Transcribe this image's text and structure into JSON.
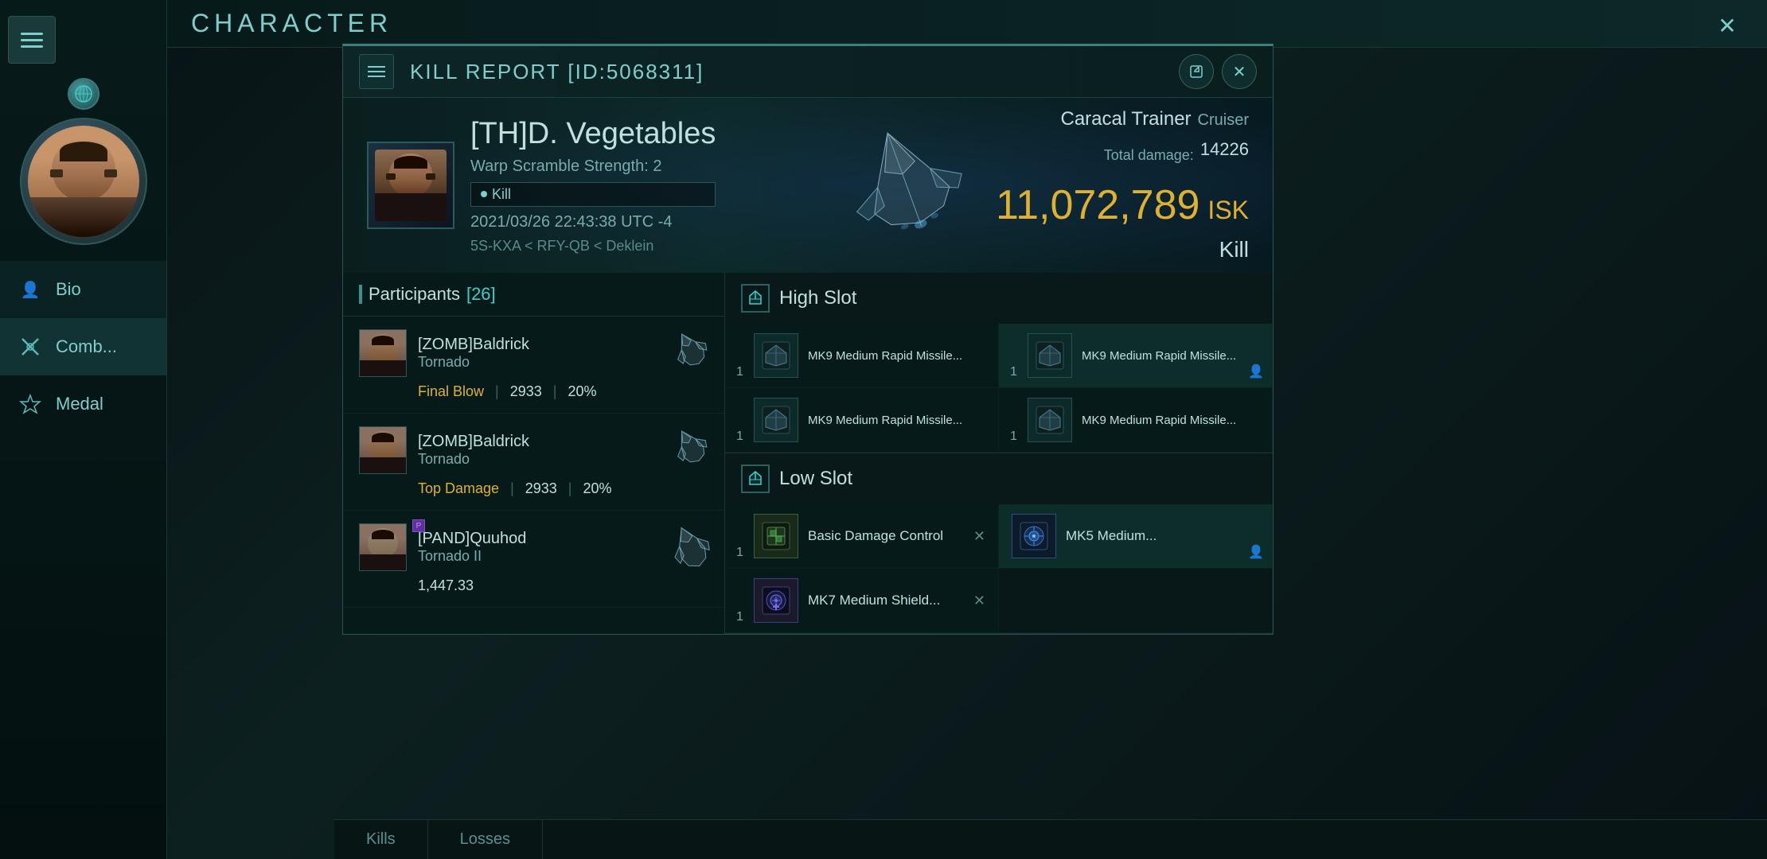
{
  "window": {
    "title": "CHARACTER",
    "close_label": "✕"
  },
  "sidebar": {
    "menu_label": "≡",
    "logo_text": "CHARACTER",
    "bio_label": "Bio",
    "nav_items": [
      {
        "id": "combat",
        "label": "Comb...",
        "icon": "⚔"
      },
      {
        "id": "medal",
        "label": "Medal",
        "icon": "★"
      }
    ]
  },
  "modal": {
    "title": "KILL REPORT [ID:5068311]",
    "export_icon": "↗",
    "close_icon": "✕"
  },
  "kill_banner": {
    "pilot_name": "[TH]D. Vegetables",
    "warp_scramble": "Warp Scramble Strength: 2",
    "kill_tag": "Kill",
    "datetime": "2021/03/26 22:43:38 UTC -4",
    "location": "5S-KXA < RFY-QB < Deklein",
    "ship_name": "Caracal Trainer",
    "ship_type": "Cruiser",
    "total_damage_label": "Total damage:",
    "total_damage_value": "14226",
    "isk_value": "11,072,789",
    "isk_label": "ISK",
    "result": "Kill"
  },
  "participants": {
    "header": "Participants",
    "count": "[26]",
    "items": [
      {
        "name": "[ZOMB]Baldrick",
        "ship": "Tornado",
        "tag": "Final Blow",
        "damage": "2933",
        "pct": "20%"
      },
      {
        "name": "[ZOMB]Baldrick",
        "ship": "Tornado",
        "tag": "Top Damage",
        "damage": "2933",
        "pct": "20%"
      },
      {
        "name": "[PAND]Quuhod",
        "ship": "Tornado II",
        "tag": "",
        "damage": "1,447.33",
        "pct": ""
      }
    ]
  },
  "fitting": {
    "high_slot": {
      "title": "High Slot",
      "items": [
        {
          "qty": "1",
          "name": "MK9 Medium Rapid Missile...",
          "highlighted": false
        },
        {
          "qty": "1",
          "name": "MK9 Medium Rapid Missile...",
          "highlighted": true
        },
        {
          "qty": "1",
          "name": "MK9 Medium Rapid Missile...",
          "highlighted": false
        },
        {
          "qty": "1",
          "name": "MK9 Medium Rapid Missile...",
          "highlighted": false
        }
      ]
    },
    "low_slot": {
      "title": "Low Slot",
      "items": [
        {
          "qty": "1",
          "name": "Basic Damage Control",
          "highlighted": false,
          "removable": true
        },
        {
          "qty": "",
          "name": "MK5 Medium...",
          "highlighted": true,
          "avatar": true
        },
        {
          "qty": "1",
          "name": "MK7 Medium Shield...",
          "highlighted": false,
          "removable": true
        },
        {
          "qty": "",
          "name": "",
          "highlighted": false
        }
      ]
    }
  },
  "bottom_tabs": [
    {
      "label": "Kills"
    },
    {
      "label": "Losses"
    }
  ],
  "colors": {
    "accent": "#3ecece",
    "text_primary": "#c0e0e0",
    "text_secondary": "#7aacac",
    "gold": "#e0b030",
    "background": "#071515",
    "panel_bg": "#0a1e1e",
    "highlight_green": "#1e5a50"
  }
}
